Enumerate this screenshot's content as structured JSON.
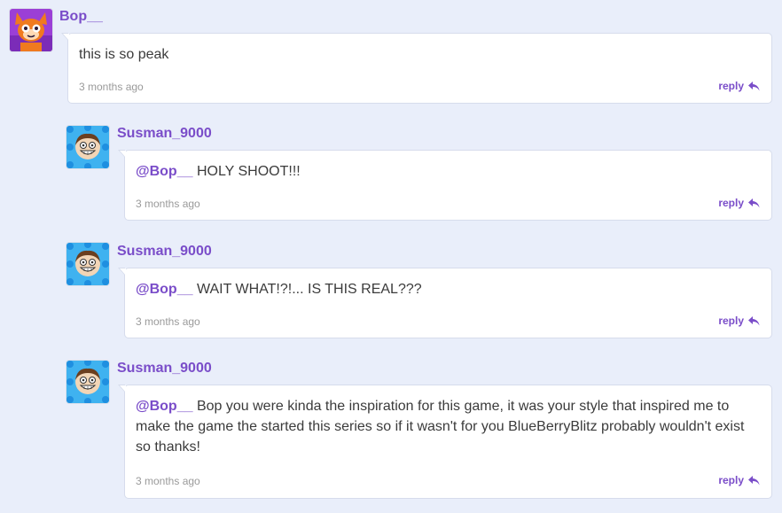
{
  "colors": {
    "background": "#e9eefa",
    "accent": "#7a4dc9",
    "bubble": "#ffffff",
    "timestamp": "#9a9a9a"
  },
  "comments": [
    {
      "username": "Bop__",
      "avatar_icon": "cat-avatar-icon",
      "body": "this is so peak",
      "timestamp": "3 months ago",
      "reply_label": "reply"
    },
    {
      "username": "Susman_9000",
      "avatar_icon": "smiling-boy-avatar-icon",
      "mention": "@Bop__",
      "body": "HOLY SHOOT!!!",
      "timestamp": "3 months ago",
      "reply_label": "reply"
    },
    {
      "username": "Susman_9000",
      "avatar_icon": "smiling-boy-avatar-icon",
      "mention": "@Bop__",
      "body": "WAIT WHAT!?!... IS THIS REAL???",
      "timestamp": "3 months ago",
      "reply_label": "reply"
    },
    {
      "username": "Susman_9000",
      "avatar_icon": "smiling-boy-avatar-icon",
      "mention": "@Bop__",
      "body": "Bop you were kinda the inspiration for this game, it was your style that inspired me to make the game the started this series so if it wasn't for you BlueBerryBlitz probably wouldn't exist so thanks!",
      "timestamp": "3 months ago",
      "reply_label": "reply"
    }
  ]
}
